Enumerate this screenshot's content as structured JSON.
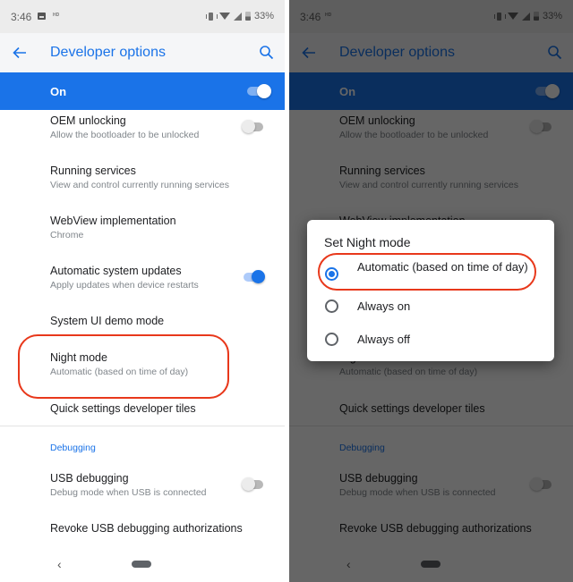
{
  "status_bar": {
    "time": "3:46",
    "hd_badge": "HD",
    "battery": "33%"
  },
  "app_bar": {
    "title": "Developer options",
    "back_icon": "arrow-back-icon",
    "search_icon": "search-icon"
  },
  "master_switch": {
    "label": "On",
    "enabled": true
  },
  "preferences": [
    {
      "title": "OEM unlocking",
      "summary": "Allow the bootloader to be unlocked",
      "toggle": "off"
    },
    {
      "title": "Running services",
      "summary": "View and control currently running services"
    },
    {
      "title": "WebView implementation",
      "summary": "Chrome"
    },
    {
      "title": "Automatic system updates",
      "summary": "Apply updates when device restarts",
      "toggle": "on"
    },
    {
      "title": "System UI demo mode"
    },
    {
      "title": "Night mode",
      "summary": "Automatic (based on time of day)"
    },
    {
      "title": "Quick settings developer tiles"
    }
  ],
  "debugging": {
    "category": "Debugging",
    "items": [
      {
        "title": "USB debugging",
        "summary": "Debug mode when USB is connected",
        "toggle": "off"
      },
      {
        "title": "Revoke USB debugging authorizations"
      }
    ]
  },
  "dialog": {
    "title": "Set Night mode",
    "options": [
      {
        "label": "Automatic (based on time of day)",
        "selected": true
      },
      {
        "label": "Always on",
        "selected": false
      },
      {
        "label": "Always off",
        "selected": false
      }
    ]
  },
  "colors": {
    "accent": "#1a73e8",
    "annotation": "#e8381b",
    "scrim": "rgba(0,0,0,0.6)"
  }
}
